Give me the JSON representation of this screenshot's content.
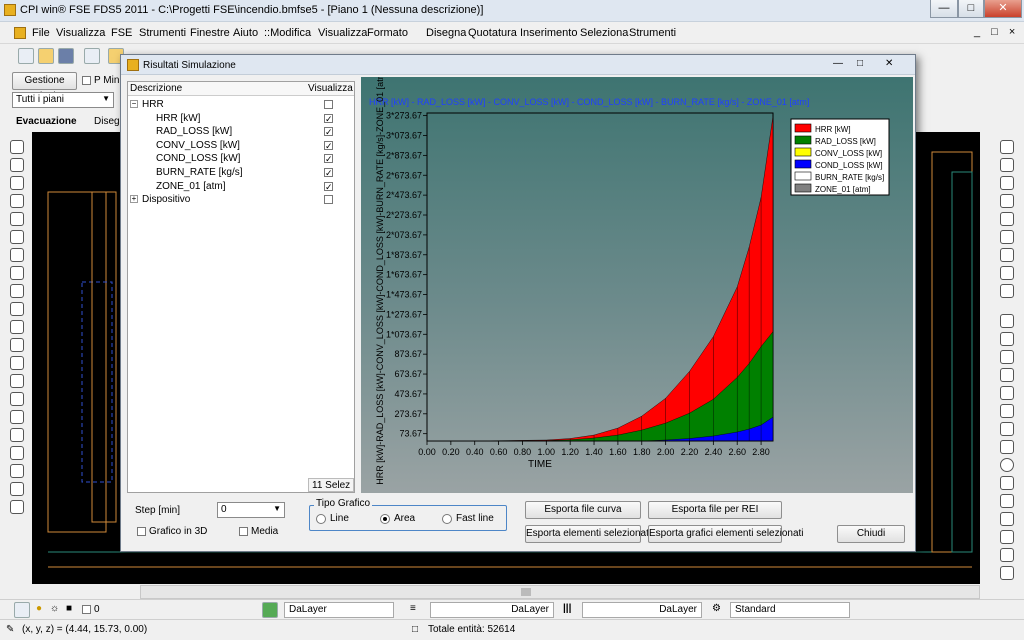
{
  "window": {
    "title": "CPI win® FSE FDS5 2011 - C:\\Progetti FSE\\incendio.bmfse5 - [Piano 1 (Nessuna descrizione)]"
  },
  "menubar": {
    "items": [
      "File",
      "Visualizza",
      "FSE",
      "Strumenti",
      "Finestre",
      "Aiuto",
      "::Modifica",
      "Visualizza",
      "Formato",
      "Disegna",
      "Quotatura",
      "Inserimento",
      "Seleziona",
      "Strumenti"
    ]
  },
  "left_panel": {
    "gestione_piani": "Gestione Piani",
    "p_min": "P Min",
    "piani_select": "Tutti i piani",
    "evacuazione": "Evacuazione",
    "disegn": "Disegn"
  },
  "dialog": {
    "title": "Risultati Simulazione",
    "tree_headers": {
      "descrizione": "Descrizione",
      "visualizza": "Visualizza"
    },
    "tree": [
      {
        "label": "HRR",
        "checked": false,
        "level": 0,
        "expander": "−"
      },
      {
        "label": "HRR [kW]",
        "checked": true,
        "level": 1
      },
      {
        "label": "RAD_LOSS [kW]",
        "checked": true,
        "level": 1
      },
      {
        "label": "CONV_LOSS [kW]",
        "checked": true,
        "level": 1
      },
      {
        "label": "COND_LOSS [kW]",
        "checked": true,
        "level": 1
      },
      {
        "label": "BURN_RATE [kg/s]",
        "checked": true,
        "level": 1
      },
      {
        "label": "ZONE_01 [atm]",
        "checked": true,
        "level": 1
      },
      {
        "label": "Dispositivo",
        "checked": false,
        "level": 0,
        "expander": "+"
      }
    ],
    "selection_count": "11 Selez",
    "step_label": "Step [min]",
    "step_value": "0",
    "grafico3d_label": "Grafico in 3D",
    "media_label": "Media",
    "tipo_grafico": {
      "legend": "Tipo Grafico",
      "options": [
        "Line",
        "Area",
        "Fast line"
      ],
      "selected": "Area"
    },
    "buttons": {
      "esporta_curva": "Esporta file curva",
      "esporta_rei": "Esporta file per REI",
      "esporta_elementi": "Esporta elementi selezionati",
      "esporta_grafici": "Esporta grafici elementi selezionati",
      "chiudi": "Chiudi"
    }
  },
  "chart_data": {
    "type": "area",
    "title": "HRR [kW] - RAD_LOSS [kW] - CONV_LOSS [kW] - COND_LOSS [kW] - BURN_RATE [kg/s] - ZONE_01 [atm]",
    "xlabel": "TIME",
    "ylabel": "HRR [kW]-RAD_LOSS [kW]-CONV_LOSS [kW]-COND_LOSS [kW]-BURN_RATE [kg/s]-ZONE_01 [atm]",
    "xlim": [
      0,
      2.9
    ],
    "ylim": [
      0,
      3300
    ],
    "x_ticks": [
      "0.00",
      "0.20",
      "0.40",
      "0.60",
      "0.80",
      "1.00",
      "1.20",
      "1.40",
      "1.60",
      "1.80",
      "2.00",
      "2.20",
      "2.40",
      "2.60",
      "2.80"
    ],
    "y_ticks": [
      "73.67",
      "273.67",
      "473.67",
      "673.67",
      "873.67",
      "1*073.67",
      "1*273.67",
      "1*473.67",
      "1*673.67",
      "1*873.67",
      "2*073.67",
      "2*273.67",
      "2*473.67",
      "2*673.67",
      "2*873.67",
      "3*073.67",
      "3*273.67"
    ],
    "x": [
      0,
      0.5,
      1.0,
      1.2,
      1.4,
      1.6,
      1.8,
      2.0,
      2.2,
      2.4,
      2.6,
      2.7,
      2.8,
      2.9
    ],
    "legend_position": "top-right",
    "grid": false,
    "series": [
      {
        "name": "HRR [kW]",
        "color": "#ff0000",
        "values": [
          0,
          2,
          10,
          25,
          60,
          130,
          250,
          430,
          700,
          1050,
          1550,
          1950,
          2450,
          3270
        ]
      },
      {
        "name": "RAD_LOSS [kW]",
        "color": "#008000",
        "values": [
          0,
          1,
          5,
          12,
          30,
          60,
          110,
          180,
          280,
          420,
          640,
          780,
          950,
          1100
        ]
      },
      {
        "name": "CONV_LOSS [kW]",
        "color": "#ffff00",
        "values": [
          0,
          0,
          0,
          0,
          0,
          0,
          0,
          0,
          0,
          0,
          0,
          0,
          0,
          0
        ]
      },
      {
        "name": "COND_LOSS [kW]",
        "color": "#0000ff",
        "values": [
          0,
          0,
          0,
          0,
          0,
          0,
          0,
          10,
          25,
          50,
          90,
          120,
          160,
          240
        ]
      },
      {
        "name": "BURN_RATE [kg/s]",
        "color": "#ffffff",
        "values": [
          0,
          0,
          0,
          0,
          0,
          0,
          0,
          0,
          0,
          0,
          0,
          0,
          0,
          0
        ]
      },
      {
        "name": "ZONE_01 [atm]",
        "color": "#808080",
        "values": [
          1,
          1,
          1,
          1,
          1,
          1,
          1,
          1,
          1,
          1,
          1,
          1,
          1,
          1
        ]
      }
    ]
  },
  "statusbar": {
    "layer_count": "0",
    "layer1": "DaLayer",
    "layer2": "DaLayer",
    "layer3": "DaLayer",
    "standard": "Standard",
    "coords": "(x, y, z) = (4.44, 15.73, 0.00)",
    "totale": "Totale entità: 52614"
  },
  "colors": {
    "cad_bg": "#000000",
    "plot_top": "#3e7471",
    "plot_bottom": "#9aa3a4"
  }
}
